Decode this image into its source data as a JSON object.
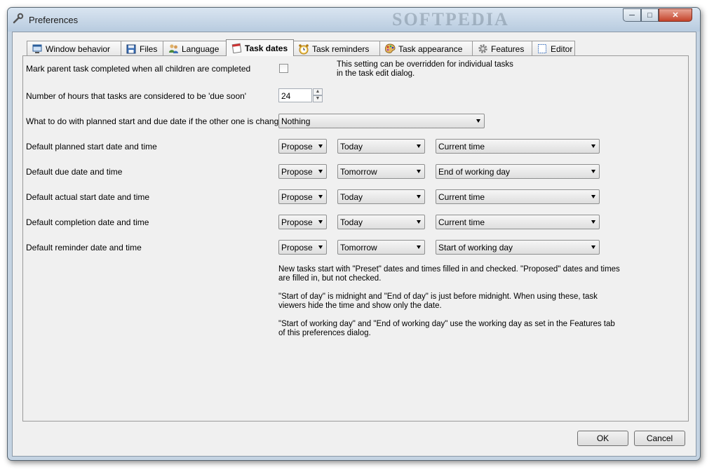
{
  "window": {
    "title": "Preferences",
    "watermark": "SOFTPEDIA"
  },
  "tabs": [
    {
      "label": "Window behavior",
      "icon": "window-icon"
    },
    {
      "label": "Files",
      "icon": "floppy-disk-icon"
    },
    {
      "label": "Language",
      "icon": "people-icon"
    },
    {
      "label": "Task dates",
      "icon": "calendar-icon",
      "active": true
    },
    {
      "label": "Task reminders",
      "icon": "alarm-clock-icon"
    },
    {
      "label": "Task appearance",
      "icon": "palette-icon"
    },
    {
      "label": "Features",
      "icon": "gear-icon"
    },
    {
      "label": "Editor",
      "icon": "editor-icon"
    }
  ],
  "settings": {
    "mark_parent_label": "Mark parent task completed when all children are completed",
    "mark_parent_checked": false,
    "override_note_line1": "This setting can be overridden for individual tasks",
    "override_note_line2": "in the task edit dialog.",
    "due_soon_label": "Number of hours that tasks are considered to be 'due soon'",
    "due_soon_value": "24",
    "planned_change_label": "What to do with planned start and due date if the other one is changed",
    "planned_change_value": "Nothing"
  },
  "defaults": [
    {
      "label": "Default planned start date and time",
      "mode": "Propose",
      "day": "Today",
      "time": "Current time"
    },
    {
      "label": "Default due date and time",
      "mode": "Propose",
      "day": "Tomorrow",
      "time": "End of working day"
    },
    {
      "label": "Default actual start date and time",
      "mode": "Propose",
      "day": "Today",
      "time": "Current time"
    },
    {
      "label": "Default completion date and time",
      "mode": "Propose",
      "day": "Today",
      "time": "Current time"
    },
    {
      "label": "Default reminder date and time",
      "mode": "Propose",
      "day": "Tomorrow",
      "time": "Start of working day"
    }
  ],
  "info": {
    "p1_line1": "New tasks start with \"Preset\" dates and times filled in and checked. \"Proposed\" dates and times",
    "p1_line2": "are filled in, but not checked.",
    "p2_line1": "\"Start of day\" is midnight and \"End of day\" is just before midnight. When using these, task",
    "p2_line2": "viewers hide the time and show only the date.",
    "p3_line1": "\"Start of working day\" and \"End of working day\" use the working day as set in the Features tab",
    "p3_line2": "of this preferences dialog."
  },
  "buttons": {
    "ok": "OK",
    "cancel": "Cancel"
  }
}
